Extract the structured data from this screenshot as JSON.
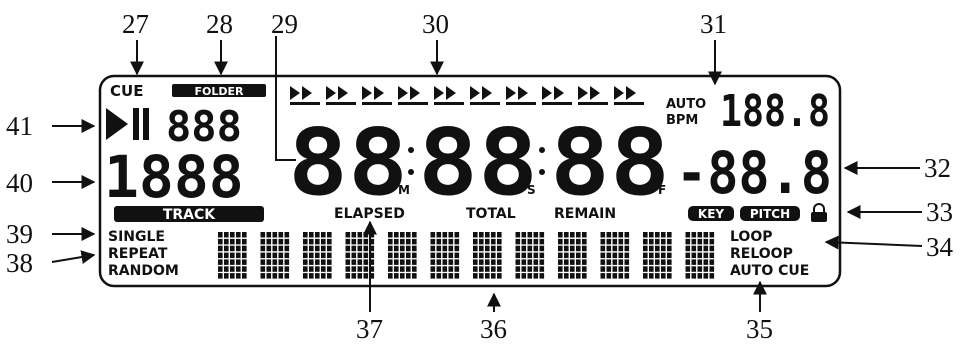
{
  "callouts": {
    "n27": "27",
    "n28": "28",
    "n29": "29",
    "n30": "30",
    "n31": "31",
    "n32": "32",
    "n33": "33",
    "n34": "34",
    "n35": "35",
    "n36": "36",
    "n37": "37",
    "n38": "38",
    "n39": "39",
    "n40": "40",
    "n41": "41"
  },
  "display": {
    "cue_label": "CUE",
    "folder_label": "FOLDER",
    "folder_digits": "888",
    "track_digits": "1888",
    "track_label": "TRACK",
    "time_min": "88",
    "time_sec": "88",
    "time_frame": "88",
    "unit_m": "M",
    "unit_s": "S",
    "unit_f": "F",
    "auto_label": "AUTO",
    "bpm_label": "BPM",
    "bpm_digits": "188.8",
    "pitch_digits": "-88.8",
    "elapsed_label": "ELAPSED",
    "total_label": "TOTAL",
    "remain_label": "REMAIN",
    "key_label": "KEY",
    "pitch_label": "PITCH",
    "single_label": "SINGLE",
    "repeat_label": "REPEAT",
    "random_label": "RANDOM",
    "loop_label": "LOOP",
    "reloop_label": "RELOOP",
    "autocue_label": "AUTO CUE"
  }
}
